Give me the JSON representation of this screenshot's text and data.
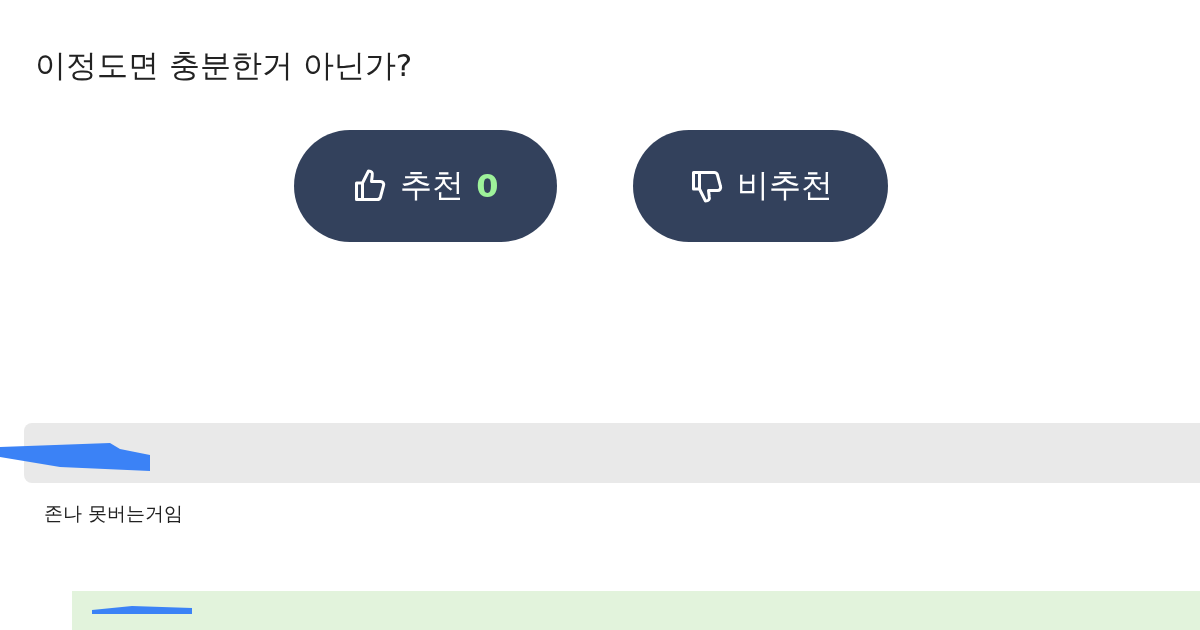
{
  "post": {
    "line": "이정도면 충분한거 아닌가?"
  },
  "votes": [
    {
      "kind": "up",
      "label": "추천",
      "count": "0"
    },
    {
      "kind": "down",
      "label": "비추천"
    }
  ],
  "comments": [
    {
      "text": "존나 못버는거임"
    }
  ]
}
